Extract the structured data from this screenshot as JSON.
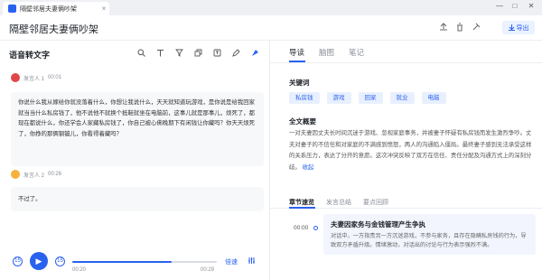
{
  "window": {
    "tab_title": "隔壁邻居夫妻俩吵架",
    "tab_close": "×",
    "minimize": "—",
    "maximize": "□",
    "close": "✕"
  },
  "header": {
    "title": "隔壁邻居夫妻俩吵架",
    "export_label": "导出"
  },
  "transcript": {
    "title": "语音转文字",
    "entries": [
      {
        "speaker": "发言人 1",
        "time": "00:01",
        "avatar_color": "#e04848",
        "text": "你说什么我从嫁给你就没落着什么，你想让我说什么，天天就知道玩游戏，是你说是给我回家就当当什么私房钱了，他不说他不就换个抵鞋就坐在电脑前，这事儿就是那事儿，烦死了，都现在都说什么，你还学会人家藏私房钱了，你自己被心佛晚期下有闲钱让你藏吗？你天天烦死了，你挣的那俩钢镚儿，你看得着藏吗？"
      },
      {
        "speaker": "发言人 2",
        "time": "00:26",
        "avatar_color": "#f5b23c",
        "text": "不过了。"
      }
    ]
  },
  "player": {
    "back_label": "15",
    "forward_label": "15",
    "current_time": "00:20",
    "total_time": "00:29",
    "progress": 0.69,
    "speed_label": "倍速"
  },
  "right": {
    "tabs": [
      "导读",
      "脑图",
      "笔记"
    ],
    "keywords_title": "关键词",
    "keywords": [
      "私房钱",
      "游戏",
      "回家",
      "就业",
      "电脑"
    ],
    "summary_title": "全文概要",
    "summary": "一对夫妻因丈夫长时间沉迷于游戏、忽视家庭事务，并被妻子怀疑有私房钱而发生激烈争吵。丈夫对妻子的不信任和对家庭的不满感到愤怒，两人的沟通陷入僵局。最终妻子感到无法承受这样的关系压力，表达了分开的意愿。这次冲突反映了双方在信任、责任分配及沟通方式上的深刻分歧。",
    "collapse_label": "收起",
    "chapter_tabs": [
      "章节速览",
      "发言总结",
      "要点回顾"
    ],
    "chapter": {
      "time": "00:00",
      "title": "夫妻因家务与金钱管理产生争执",
      "body": "对话中，一方指责另一方沉迷游戏，不参与家务，且存在隐瞒私房钱的行为，导致双方矛盾升级。情绪激动，对话出的讨论与行为表示强烈不满。"
    }
  },
  "colors": {
    "accent": "#2a62f0",
    "keyword_bg": "#e8f0ff"
  }
}
